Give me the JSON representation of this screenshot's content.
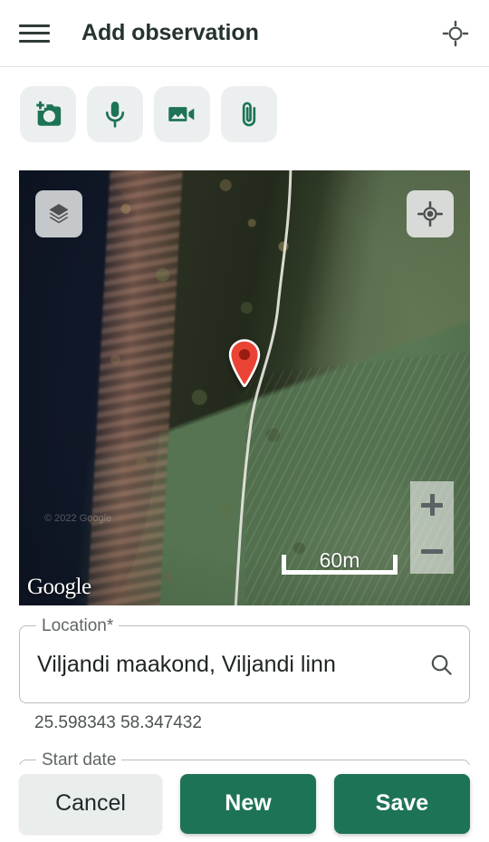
{
  "header": {
    "menu_icon": "hamburger-menu-icon",
    "title": "Add observation",
    "gps_icon": "location-searching-icon"
  },
  "media_toolbar": {
    "buttons": [
      {
        "name": "add-photo",
        "icon": "add-a-photo-icon",
        "label": "Add photo"
      },
      {
        "name": "record-audio",
        "icon": "microphone-icon",
        "label": "Record audio"
      },
      {
        "name": "record-video",
        "icon": "video-camera-icon",
        "label": "Record video"
      },
      {
        "name": "attach-file",
        "icon": "paperclip-icon",
        "label": "Attach file"
      }
    ]
  },
  "map": {
    "provider": "Google",
    "attribution": "© 2022 Google",
    "scale_label": "60m",
    "layers_icon": "map-layers-icon",
    "locate_icon": "my-location-icon",
    "zoom_in_label": "+",
    "zoom_out_label": "−",
    "marker_color": "#ea4335",
    "marker_icon": "map-pin-icon"
  },
  "form": {
    "location": {
      "label": "Location*",
      "value": "Viljandi maakond, Viljandi linn",
      "placeholder": "Location",
      "search_icon": "search-icon",
      "coordinates": "25.598343 58.347432"
    },
    "start_date": {
      "label": "Start date",
      "value": ""
    }
  },
  "bottom_bar": {
    "cancel_label": "Cancel",
    "new_label": "New",
    "save_label": "Save",
    "primary_color": "#1d7356",
    "cancel_color": "#e9edec"
  }
}
